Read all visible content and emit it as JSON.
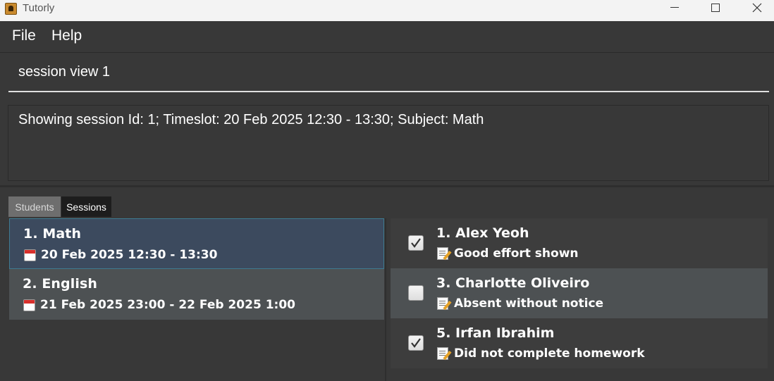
{
  "window": {
    "title": "Tutorly"
  },
  "menu": {
    "file": "File",
    "help": "Help"
  },
  "command": {
    "value": "session view 1"
  },
  "result": {
    "text": "Showing session Id: 1; Timeslot: 20 Feb 2025 12:30 - 13:30; Subject: Math"
  },
  "tabs": {
    "students": "Students",
    "sessions": "Sessions",
    "active": "Sessions"
  },
  "sessions": [
    {
      "title": "1. Math",
      "timeslot": "20 Feb 2025 12:30 - 13:30",
      "selected": true
    },
    {
      "title": "2. English",
      "timeslot": "21 Feb 2025 23:00 - 22 Feb 2025 1:00",
      "selected": false
    }
  ],
  "attendance": [
    {
      "name": "1. Alex Yeoh",
      "note": "Good effort shown",
      "present": true
    },
    {
      "name": "3. Charlotte Oliveiro",
      "note": "Absent without notice",
      "present": false
    },
    {
      "name": "5. Irfan Ibrahim",
      "note": "Did not complete homework",
      "present": true
    }
  ],
  "icons": {
    "timeslot": "calendar-icon",
    "note": "memo-icon"
  }
}
